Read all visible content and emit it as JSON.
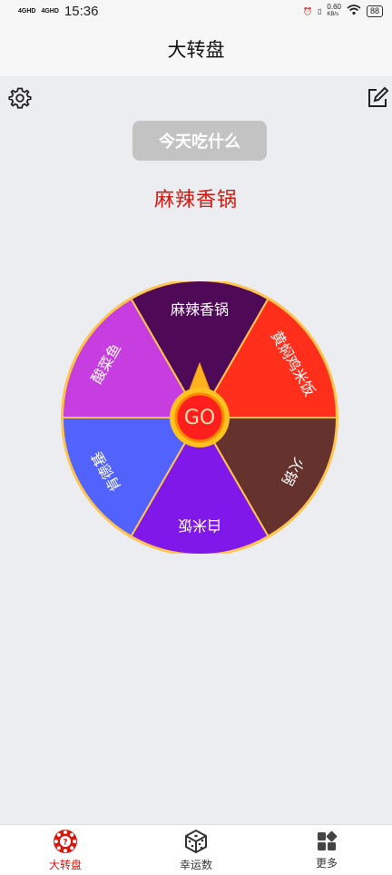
{
  "statusbar": {
    "time": "15:36",
    "signal1": "4GHD",
    "signal2": "4GHD",
    "speed_value": "0.60",
    "speed_unit": "KB/s",
    "battery": "88"
  },
  "header": {
    "title": "大转盘"
  },
  "actions": {
    "eat_button": "今天吃什么"
  },
  "result": {
    "text": "麻辣香锅"
  },
  "wheel": {
    "center_label": "GO",
    "segments": [
      {
        "label": "麻辣香锅",
        "color": "#4f0a57"
      },
      {
        "label": "黄焖鸡米饭",
        "color": "#ff2f1c"
      },
      {
        "label": "火锅",
        "color": "#66322e"
      },
      {
        "label": "白米饭",
        "color": "#7f18e9"
      },
      {
        "label": "肯德基",
        "color": "#5163fc"
      },
      {
        "label": "酸菜鱼",
        "color": "#c73ee0"
      }
    ],
    "border_color": "#ffc44d",
    "accent": "#d6180f"
  },
  "tabbar": {
    "items": [
      {
        "label": "大转盘",
        "icon": "wheel-icon",
        "active": true
      },
      {
        "label": "幸运数",
        "icon": "dice-icon",
        "active": false
      },
      {
        "label": "更多",
        "icon": "grid-icon",
        "active": false
      }
    ]
  }
}
